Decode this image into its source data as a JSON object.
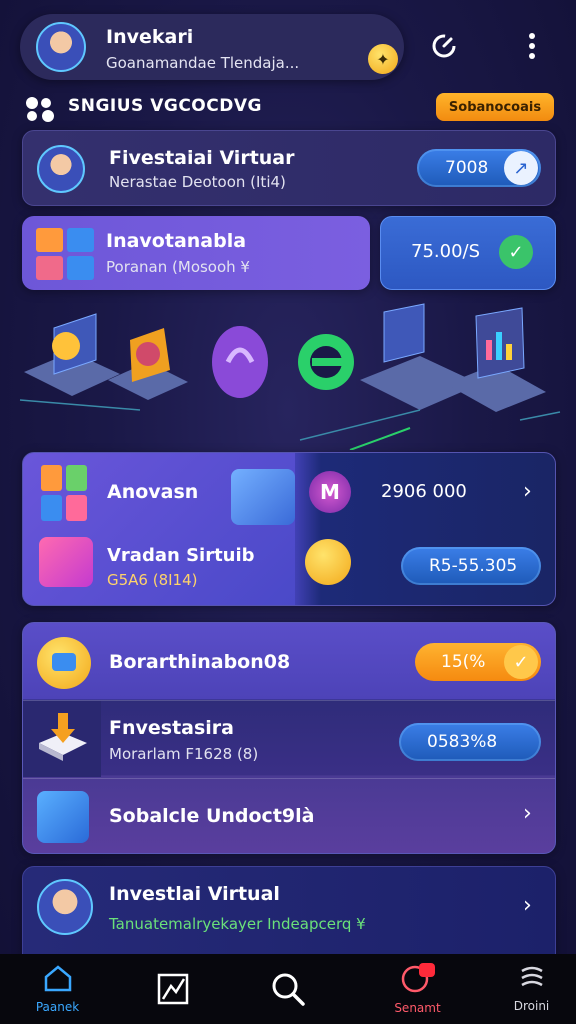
{
  "header": {
    "title": "Invekari",
    "subtitle": "Goanamandae Tlendaja...",
    "coin_icon": "coin-icon",
    "refresh_icon": "refresh-icon",
    "more_icon": "more-vertical-icon"
  },
  "section": {
    "label": "SNGIUS VGCOCDVG",
    "badge": "Sobanocoais"
  },
  "card1": {
    "title": "Fivestaiai Virtuar",
    "subtitle": "Nerastae Deotoon (Iti4)",
    "value": "7008"
  },
  "card2": {
    "title": "Inavotanabla",
    "subtitle": "Poranan (Mosooh ¥"
  },
  "card3": {
    "value": "75.00/S"
  },
  "card4": {
    "row1_label": "Anovasn",
    "row1_badge": "M",
    "row1_value": "2906 000",
    "row2_title": "Vradan Sirtuib",
    "row2_sub": "G5A6 (8I14)",
    "row2_value": "R5-55.305"
  },
  "card5": {
    "row1_title": "Borarthinabon08",
    "row1_value": "15(%",
    "row2_title": "Fnvestasira",
    "row2_sub": "Morarlam F1628 (8)",
    "row2_value": "0583%8",
    "row3_title": "Sobalcle Undoct9là"
  },
  "card6": {
    "title": "Investlai Virtual",
    "subtitle": "Tanuatemalryekayer Indeapcerq ¥"
  },
  "nav": [
    {
      "label": "Paanek",
      "icon": "home-icon",
      "color": "#3aa8ff"
    },
    {
      "label": "",
      "icon": "chart-icon",
      "color": "#ffffff"
    },
    {
      "label": "",
      "icon": "search-icon",
      "color": "#ffffff"
    },
    {
      "label": "Senamt",
      "icon": "notification-icon",
      "color": "#ff5a6a"
    },
    {
      "label": "Droini",
      "icon": "menu-icon",
      "color": "#d8d8e0"
    }
  ],
  "colors": {
    "accent_blue": "#2f6fd8",
    "accent_orange": "#f59a18",
    "accent_green": "#3ac46a",
    "background": "#1a1847"
  }
}
